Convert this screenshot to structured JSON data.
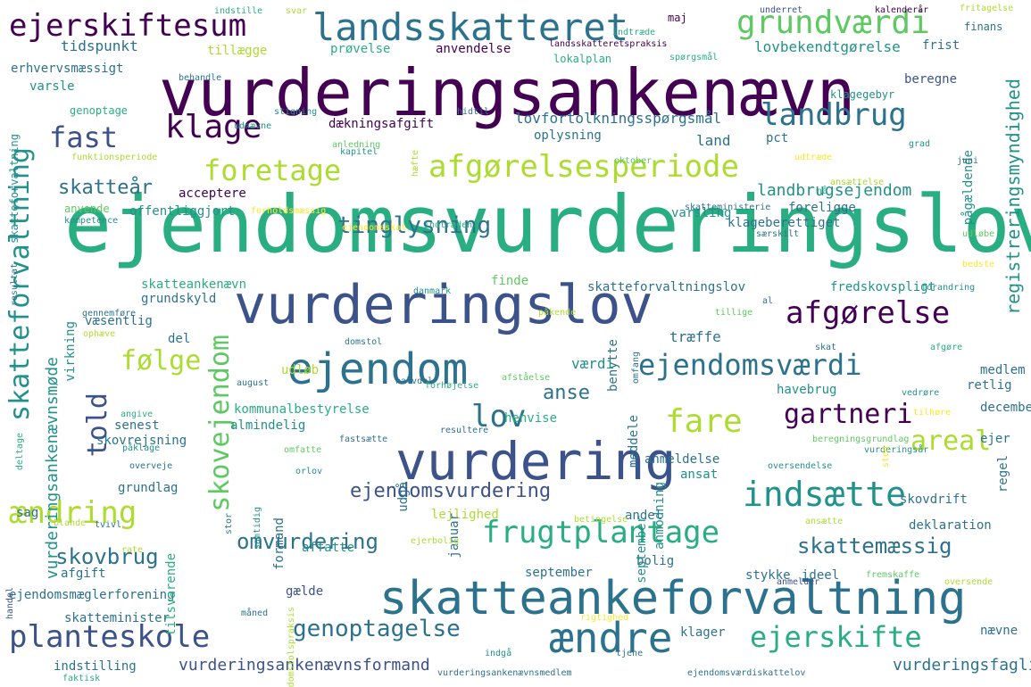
{
  "palette": {
    "background": "#ffffff",
    "colors": [
      "#440154",
      "#472d7b",
      "#3b528b",
      "#2c728e",
      "#21918c",
      "#28ae80",
      "#5ec962",
      "#addc30",
      "#fde725"
    ]
  },
  "words": [
    "ejendomsvurderingslov",
    "vurderingsankenævn",
    "vurderingslov",
    "vurdering",
    "skatteankeforvaltning",
    "ejendom",
    "landsskatteret",
    "grundværdi",
    "ejerskiftesum",
    "afgørelsesperiode",
    "foretage",
    "landbrug",
    "klage",
    "afgørelse",
    "fast",
    "skatteforvaltning",
    "skovejendom",
    "frugtplantage",
    "ejendomsværdi",
    "gartneri",
    "planteskole",
    "ændre",
    "indsætte",
    "ejerskifte",
    "told",
    "ændring",
    "fare",
    "lov",
    "areal",
    "følge",
    "tinglysning",
    "skovbrug",
    "omvurdering",
    "genoptagelse",
    "skattemæssig",
    "ejendomsvurdering",
    "anse",
    "skatteår",
    "landbrugsejendom",
    "vurderingsankenævnsformand",
    "vurderingsfaglig",
    "registreringsmyndighed",
    "lovbekendtgørelse",
    "vurderingsankenævnsmøde",
    "dækningsafgift",
    "lovfortolkningsspørgsmål",
    "tidspunkt",
    "anvendelse",
    "prøvelse",
    "tillægge",
    "erhvervsmæssigt",
    "varsle",
    "beregne",
    "pågældende",
    "oplysning",
    "land",
    "pct",
    "acceptere",
    "offentliggjort",
    "varsling",
    "foreligge",
    "klageberettiget",
    "fredskovspligt",
    "skatteforvaltningslov",
    "skatteankenævn",
    "kommunalbestyrelse",
    "almindelig",
    "virkning",
    "skovrejsning",
    "havebrug",
    "senest",
    "benytte",
    "træffe",
    "værdi",
    "udløb",
    "grundskyld",
    "væsentlig",
    "del",
    "finde",
    "henvise",
    "anmeldelse",
    "ansat",
    "afgift",
    "grundlag",
    "sag",
    "lejlighed",
    "andel",
    "deklaration",
    "skovdrift",
    "september",
    "bolig",
    "stykke",
    "ideel",
    "gælde",
    "skatteminister",
    "ejendomsmæglerforening",
    "klager",
    "nævne",
    "indstilling",
    "affatte",
    "tilsvarende",
    "formand",
    "januar",
    "udgå",
    "meddele",
    "medlem",
    "retlig",
    "december",
    "ejer",
    "regel",
    "anmodning",
    "september",
    "maj",
    "finans",
    "frist",
    "klagegebyr",
    "indstille",
    "svar",
    "underret",
    "kalenderår",
    "fritagelse",
    "indtræde",
    "landsskatteretspraksis",
    "behandle",
    "lokalplan",
    "spørgsmål",
    "genoptage",
    "stigning",
    "hidtil",
    "udnævne",
    "anledning",
    "funktionsperiode",
    "kapitel",
    "hæfte",
    "oktober",
    "udtræde",
    "grad",
    "juni",
    "ansættelse",
    "nå",
    "kompetence",
    "anvende",
    "forholdsmæssig",
    "skatteministerie",
    "ejendomsskat",
    "indtræden",
    "særskilt",
    "udløbe",
    "resultat",
    "danmark",
    "påkende",
    "tillige",
    "al",
    "forandring",
    "bedste",
    "gennemføre",
    "ophæve",
    "domstol",
    "skat",
    "afgøre",
    "august",
    "halvdel",
    "forhøjelse",
    "omfang",
    "afståelse",
    "vedrøre",
    "tilhøre",
    "angive",
    "deltage",
    "påklage",
    "omfatte",
    "fastsætte",
    "resultere",
    "beregningsgrundlag",
    "overveje",
    "orlov",
    "vurderingsår",
    "oversendelse",
    "sted",
    "samtidig",
    "stor",
    "blande",
    "tvivl",
    "handel",
    "rate",
    "betingelse",
    "ejerbolig",
    "ansætte",
    "anmelder",
    "oversende",
    "måned",
    "domstolspraksis",
    "rigtighed",
    "indgå",
    "tjene",
    "faktisk",
    "vurderingsankenævnsmedlem",
    "ejendomsværdiskattelov",
    "fremskaffe",
    "skatteforvaltning"
  ]
}
